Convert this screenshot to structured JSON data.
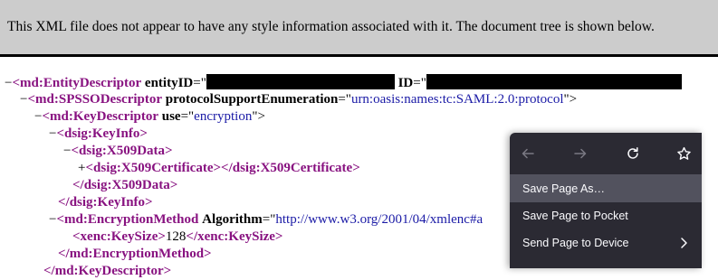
{
  "banner": {
    "text": "This XML file does not appear to have any style information associated with it. The document tree is shown below."
  },
  "tree": {
    "toggle_collapse": "−",
    "toggle_expand": "+",
    "lines": [
      {
        "open": "<md:EntityDescriptor",
        "attr1": "entityID",
        "eq": "=\"",
        "attr2": "ID",
        "eq2": "=\""
      },
      {
        "open": "<md:SPSSODescriptor",
        "attr": "protocolSupportEnumeration",
        "eq": "=\"",
        "value": "urn:oasis:names:tc:SAML:2.0:protocol",
        "close": "\">"
      },
      {
        "open": "<md:KeyDescriptor",
        "attr": "use",
        "eq": "=\"",
        "value": "encryption",
        "close": "\">"
      },
      {
        "tag": "<dsig:KeyInfo>"
      },
      {
        "tag": "<dsig:X509Data>"
      },
      {
        "open": "<dsig:X509Certificate>",
        "mid": "</dsig:X509Certificate>"
      },
      {
        "tag": "</dsig:X509Data>"
      },
      {
        "tag": "</dsig:KeyInfo>"
      },
      {
        "open": "<md:EncryptionMethod",
        "attr": "Algorithm",
        "eq": "=\"",
        "value": "http://www.w3.org/2001/04/xmlenc#a"
      },
      {
        "open": "<xenc:KeySize>",
        "text": "128",
        "close": "</xenc:KeySize>"
      },
      {
        "tag": "</md:EncryptionMethod>"
      },
      {
        "tag": "</md:KeyDescriptor>"
      }
    ]
  },
  "context_menu": {
    "nav": {
      "back_icon": "arrow-left-icon",
      "forward_icon": "arrow-right-icon",
      "reload_icon": "reload-icon",
      "bookmark_icon": "star-icon"
    },
    "items": [
      {
        "label": "Save Page As…",
        "highlighted": true
      },
      {
        "label": "Save Page to Pocket",
        "highlighted": false
      },
      {
        "label": "Send Page to Device",
        "submenu": true,
        "highlighted": false
      }
    ],
    "colors": {
      "background": "#2b2a33",
      "highlight": "#52525e",
      "text": "#fbfbfe"
    }
  }
}
